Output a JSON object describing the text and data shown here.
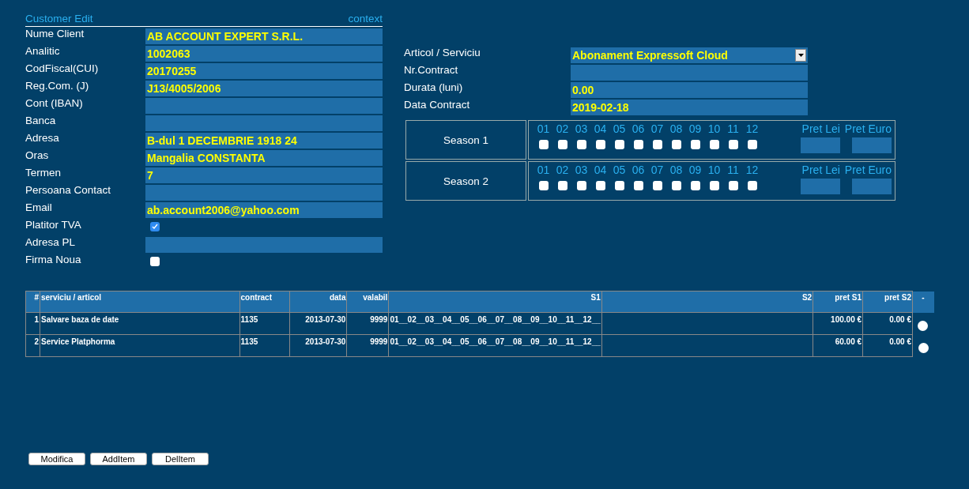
{
  "header": {
    "title": "Customer Edit",
    "context": "context"
  },
  "customer_fields": [
    {
      "label": "Nume Client",
      "kind": "text",
      "value": "AB ACCOUNT EXPERT S.R.L."
    },
    {
      "label": "Analitic",
      "kind": "text",
      "value": "1002063"
    },
    {
      "label": "CodFiscal(CUI)",
      "kind": "text",
      "value": "20170255"
    },
    {
      "label": "Reg.Com. (J)",
      "kind": "text",
      "value": "J13/4005/2006"
    },
    {
      "label": "Cont (IBAN)",
      "kind": "text"
    },
    {
      "label": "Banca",
      "kind": "text"
    },
    {
      "label": "Adresa",
      "kind": "text",
      "value": "B-dul 1 DECEMBRIE 1918  24"
    },
    {
      "label": "Oras",
      "kind": "text",
      "value": "Mangalia CONSTANTA"
    },
    {
      "label": "Termen",
      "kind": "text",
      "value": "7"
    },
    {
      "label": "Persoana Contact",
      "kind": "text"
    },
    {
      "label": "Email",
      "kind": "text",
      "value": "ab.account2006@yahoo.com"
    },
    {
      "label": "Platitor TVA",
      "kind": "checkbox",
      "checked": true
    },
    {
      "label": "Adresa PL",
      "kind": "text"
    },
    {
      "label": "Firma Noua",
      "kind": "checkbox",
      "checked": false
    }
  ],
  "contract_fields": [
    {
      "label": "Articol / Serviciu",
      "kind": "select",
      "value": "Abonament Expressoft Cloud"
    },
    {
      "label": "Nr.Contract",
      "kind": "text"
    },
    {
      "label": "Durata (luni)",
      "kind": "text",
      "value": "0.00"
    },
    {
      "label": "Data Contract",
      "kind": "text",
      "value": "2019-02-18"
    }
  ],
  "seasons": [
    {
      "name": "Season 1",
      "price_lei_label": "Pret Lei",
      "price_euro_label": "Pret Euro",
      "months": [
        {
          "label": "01",
          "checked": false
        },
        {
          "label": "02",
          "checked": false
        },
        {
          "label": "03",
          "checked": false
        },
        {
          "label": "04",
          "checked": false
        },
        {
          "label": "05",
          "checked": false
        },
        {
          "label": "06",
          "checked": false
        },
        {
          "label": "07",
          "checked": false
        },
        {
          "label": "08",
          "checked": false
        },
        {
          "label": "09",
          "checked": false
        },
        {
          "label": "10",
          "checked": false
        },
        {
          "label": "11",
          "checked": false
        },
        {
          "label": "12",
          "checked": false
        }
      ]
    },
    {
      "name": "Season 2",
      "price_lei_label": "Pret Lei",
      "price_euro_label": "Pret Euro",
      "months": [
        {
          "label": "01",
          "checked": false
        },
        {
          "label": "02",
          "checked": false
        },
        {
          "label": "03",
          "checked": false
        },
        {
          "label": "04",
          "checked": false
        },
        {
          "label": "05",
          "checked": false
        },
        {
          "label": "06",
          "checked": false
        },
        {
          "label": "07",
          "checked": false
        },
        {
          "label": "08",
          "checked": false
        },
        {
          "label": "09",
          "checked": false
        },
        {
          "label": "10",
          "checked": false
        },
        {
          "label": "11",
          "checked": false
        },
        {
          "label": "12",
          "checked": false
        }
      ]
    }
  ],
  "table": {
    "columns": [
      "#",
      "serviciu / articol",
      "contract",
      "data",
      "valabil",
      "S1",
      "S2",
      "pret S1",
      "pret S2",
      "-"
    ],
    "rows": [
      {
        "cells": [
          "1",
          "Salvare baza de date",
          "1135",
          "2013-07-30",
          "9999",
          "01__02__03__04__05__06__07__08__09__10__11__12__",
          "",
          "100.00 €",
          "0.00 €"
        ],
        "selected": false
      },
      {
        "cells": [
          "2",
          "Service Platphorma",
          "1135",
          "2013-07-30",
          "9999",
          "01__02__03__04__05__06__07__08__09__10__11__12__",
          "",
          "60.00 €",
          "0.00 €"
        ],
        "selected": false
      }
    ]
  },
  "buttons": [
    "Modifica",
    "AddItem",
    "DelItem"
  ]
}
